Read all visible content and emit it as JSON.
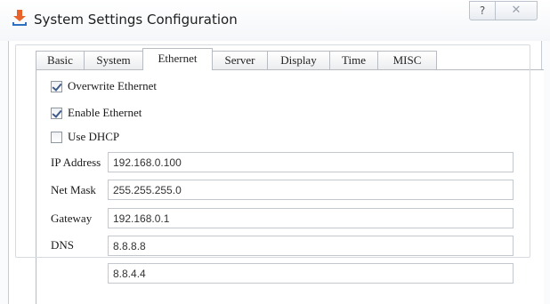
{
  "window": {
    "title": "System Settings Configuration",
    "help_glyph": "?",
    "close_glyph": "✕"
  },
  "tabs": [
    {
      "label": "Basic"
    },
    {
      "label": "System"
    },
    {
      "label": "Ethernet",
      "active": true
    },
    {
      "label": "Server"
    },
    {
      "label": "Display"
    },
    {
      "label": "Time"
    },
    {
      "label": "MISC"
    }
  ],
  "ethernet": {
    "group_label": "Overwrite Ethernet",
    "overwrite_checked": true,
    "enable_label": "Enable Ethernet",
    "enable_checked": true,
    "dhcp_label": "Use DHCP",
    "dhcp_checked": false,
    "ip_label": "IP Address",
    "ip_value": "192.168.0.100",
    "netmask_label": "Net Mask",
    "netmask_value": "255.255.255.0",
    "gateway_label": "Gateway",
    "gateway_value": "192.168.0.1",
    "dns_label": "DNS",
    "dns1_value": "8.8.8.8",
    "dns2_value": "8.8.4.4"
  },
  "colors": {
    "app_icon_orange": "#e8632b",
    "app_icon_blue": "#2f6fc0",
    "check_mark": "#3c5a8a"
  }
}
